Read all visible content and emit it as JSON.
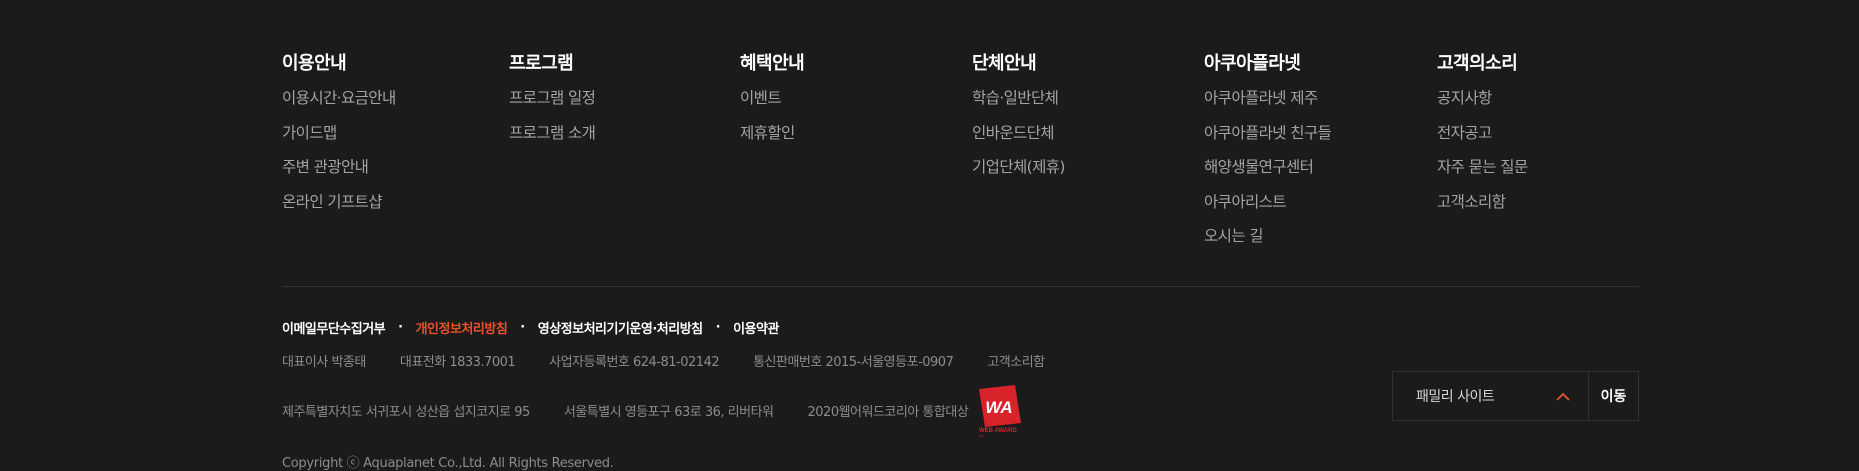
{
  "nav": [
    {
      "title": "이용안내",
      "items": [
        "이용시간·요금안내",
        "가이드맵",
        "주변 관광안내",
        "온라인 기프트샵"
      ]
    },
    {
      "title": "프로그램",
      "items": [
        "프로그램 일정",
        "프로그램 소개"
      ]
    },
    {
      "title": "혜택안내",
      "items": [
        "이벤트",
        "제휴할인"
      ]
    },
    {
      "title": "단체안내",
      "items": [
        "학습·일반단체",
        "인바운드단체",
        "기업단체(제휴)"
      ]
    },
    {
      "title": "아쿠아플라넷",
      "items": [
        "아쿠아플라넷 제주",
        "아쿠아플라넷 친구들",
        "해양생물연구센터",
        "아쿠아리스트",
        "오시는 길"
      ]
    },
    {
      "title": "고객의소리",
      "items": [
        "공지사항",
        "전자공고",
        "자주 묻는 질문",
        "고객소리함"
      ]
    }
  ],
  "policies": [
    {
      "label": "이메일무단수집거부"
    },
    {
      "label": "개인정보처리방침",
      "accent": true
    },
    {
      "label": "영상정보처리기기운영·처리방침"
    },
    {
      "label": "이용약관"
    }
  ],
  "policy_separator": "·",
  "company_info": {
    "ceo": "대표이사 박종태",
    "phone": "대표전화 1833.7001",
    "biz_no": "사업자등록번호 624-81-02142",
    "mail_order": "통신판매번호 2015-서울영등포-0907",
    "voice": "고객소리함"
  },
  "addresses": {
    "jeju": "제주특별자치도 서귀포시 성산읍 섭지코지로 95",
    "seoul": "서울특별시 영등포구 63로 36, 리버타워",
    "award": "2020웹어워드코리아 통합대상"
  },
  "award_badge": {
    "logo_text": "WA",
    "caption": "WEB AWARD",
    "sub": "20"
  },
  "copyright": "Copyright ⓒ Aquaplanet Co.,Ltd. All Rights Reserved.",
  "family_site": {
    "label": "패밀리 사이트",
    "go_label": "이동"
  },
  "colors": {
    "background": "#1b1b1b",
    "accent": "#e8512a",
    "award_red": "#d8232a"
  }
}
